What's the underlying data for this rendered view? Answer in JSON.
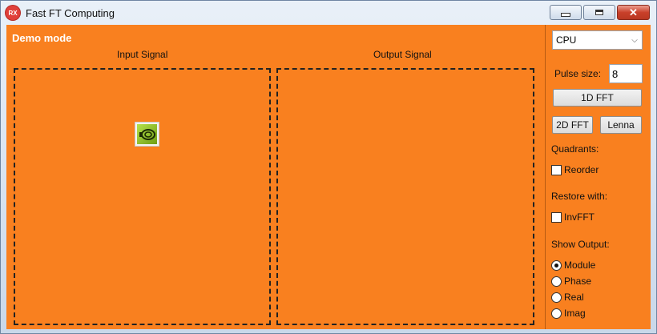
{
  "window": {
    "icon_text": "RX",
    "title": "Fast FT Computing",
    "close_glyph": "✕"
  },
  "main": {
    "mode_label": "Demo mode",
    "input_panel_label": "Input Signal",
    "output_panel_label": "Output Signal",
    "input_icon": "nvidia-logo-icon"
  },
  "side": {
    "device": {
      "selected": "CPU",
      "chevron": "⌵"
    },
    "pulse_size": {
      "label": "Pulse size:",
      "value": "8"
    },
    "fft1d_label": "1D FFT",
    "fft2d_label": "2D FFT",
    "lenna_label": "Lenna",
    "quadrants": {
      "label": "Quadrants:",
      "checkbox_label": "Reorder",
      "checked": false
    },
    "restore": {
      "label": "Restore with:",
      "checkbox_label": "InvFFT",
      "checked": false
    },
    "show_output": {
      "label": "Show Output:",
      "options": [
        {
          "label": "Module",
          "selected": true
        },
        {
          "label": "Phase",
          "selected": false
        },
        {
          "label": "Real",
          "selected": false
        },
        {
          "label": "Imag",
          "selected": false
        }
      ]
    }
  },
  "colors": {
    "client_bg": "#f9801f",
    "title_gradient_top": "#e9f0f8",
    "close_red": "#c9402a"
  }
}
